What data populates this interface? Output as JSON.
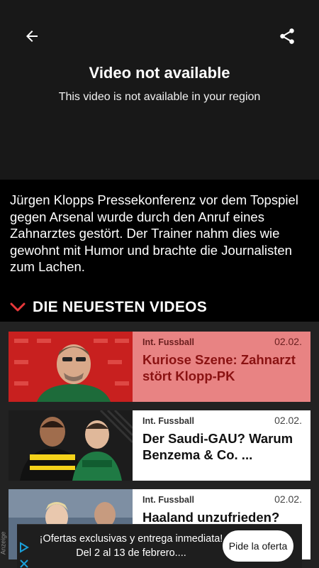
{
  "player": {
    "back_icon": "arrow-left-icon",
    "share_icon": "share-icon",
    "title": "Video not available",
    "subtitle": "This video is not available in your region"
  },
  "article": {
    "text": "Jürgen Klopps Pressekonferenz vor dem Topspiel gegen Arsenal wurde durch den Anruf eines Zahnarztes gestört. Der Trainer nahm dies wie gewohnt mit Humor und brachte die Journalisten zum Lachen."
  },
  "section": {
    "chevron_icon": "chevron-down-icon",
    "title": "DIE NEUESTEN VIDEOS",
    "accent": "#e8383a"
  },
  "videos": [
    {
      "category": "Int. Fussball",
      "date": "02.02.",
      "headline": "Kuriose Szene: Zahnarzt stört Klopp-PK"
    },
    {
      "category": "Int. Fussball",
      "date": "02.02.",
      "headline": "Der Saudi-GAU? Warum Benzema & Co. ..."
    },
    {
      "category": "Int. Fussball",
      "date": "02.02.",
      "headline": "Haaland unzufrieden?"
    }
  ],
  "ad": {
    "label": "Anzeige",
    "text": "¡Ofertas exclusivas y entrega inmediata! Del 2 al 13 de febrero....",
    "cta": "Pide la oferta"
  }
}
